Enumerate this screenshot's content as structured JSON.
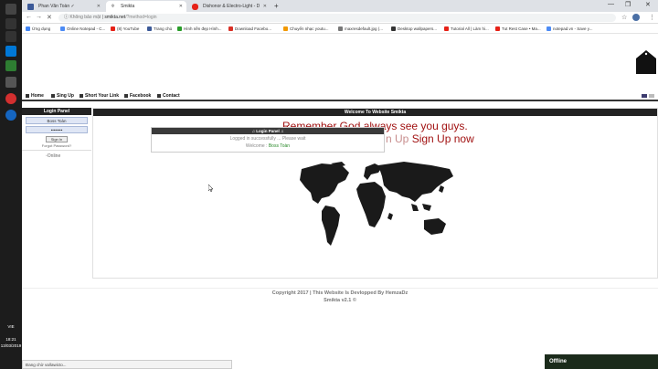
{
  "browser": {
    "tabs": [
      {
        "label": "Phan Văn Toàn ✓",
        "favicon_color": "#3b5998"
      },
      {
        "label": "Smikta",
        "favicon_color": "#888888"
      },
      {
        "label": "Dishonor & Electro-Light - D",
        "favicon_color": "#e62117"
      }
    ],
    "address": {
      "insecure_label": "Không bảo mật",
      "domain": "smikta.net",
      "path": "/?method=login"
    },
    "bookmarks": [
      {
        "label": "Ứng dụng",
        "color": "#4285f4"
      },
      {
        "label": "Online Notepad - C...",
        "color": "#4c8bf5"
      },
      {
        "label": "(8) YouTube",
        "color": "#e62117"
      },
      {
        "label": "Trang chủ",
        "color": "#3b5998"
      },
      {
        "label": "Hình nền đẹp Hình...",
        "color": "#2a9d2a"
      },
      {
        "label": "Download Facebo...",
        "color": "#d93025"
      },
      {
        "label": "Chuyển nhạc youtu...",
        "color": "#f29900"
      },
      {
        "label": "maxresdefault.jpg (...",
        "color": "#777777"
      },
      {
        "label": "Desktop wallpapers...",
        "color": "#333333"
      },
      {
        "label": "Tutorial All | Làm hi...",
        "color": "#e62117"
      },
      {
        "label": "Tut Rest Case • Ma...",
        "color": "#e62117"
      },
      {
        "label": "notepad.vn - Save y...",
        "color": "#4c8bf5"
      }
    ]
  },
  "taskbar": {
    "lang": "VIE",
    "time": "18:21",
    "date": "13/03/2019"
  },
  "site": {
    "nav": [
      "Home",
      "Sing Up",
      "Short Your Link",
      "Facebook",
      "Contact"
    ],
    "login_panel": {
      "title": "Login Panel",
      "username": "Boss Toàn",
      "password": "••••••••",
      "signin_label": "Sign In",
      "forgot_label": "Forgot Password?",
      "online_label": "Online"
    },
    "main": {
      "title": "Welcome To Website Smikta",
      "motto_line1": "Remember God always see you guys.",
      "motto_line2_faded": "n Up",
      "motto_line2": "Sign Up now"
    },
    "popup": {
      "title": "♫ Login Panel ♫",
      "message": "Logged in successfully ... Please wait",
      "welcome_prefix": "Welcome :",
      "welcome_user": "Boss Toàn"
    },
    "footer": {
      "line1": "Copyright 2017 | This Website Is Devlopped By HemzaDz",
      "line2": "Smikta v2.1 ©"
    }
  },
  "status_bar": "Đang chờ va/lawicto...",
  "chat": {
    "label": "Offline"
  }
}
